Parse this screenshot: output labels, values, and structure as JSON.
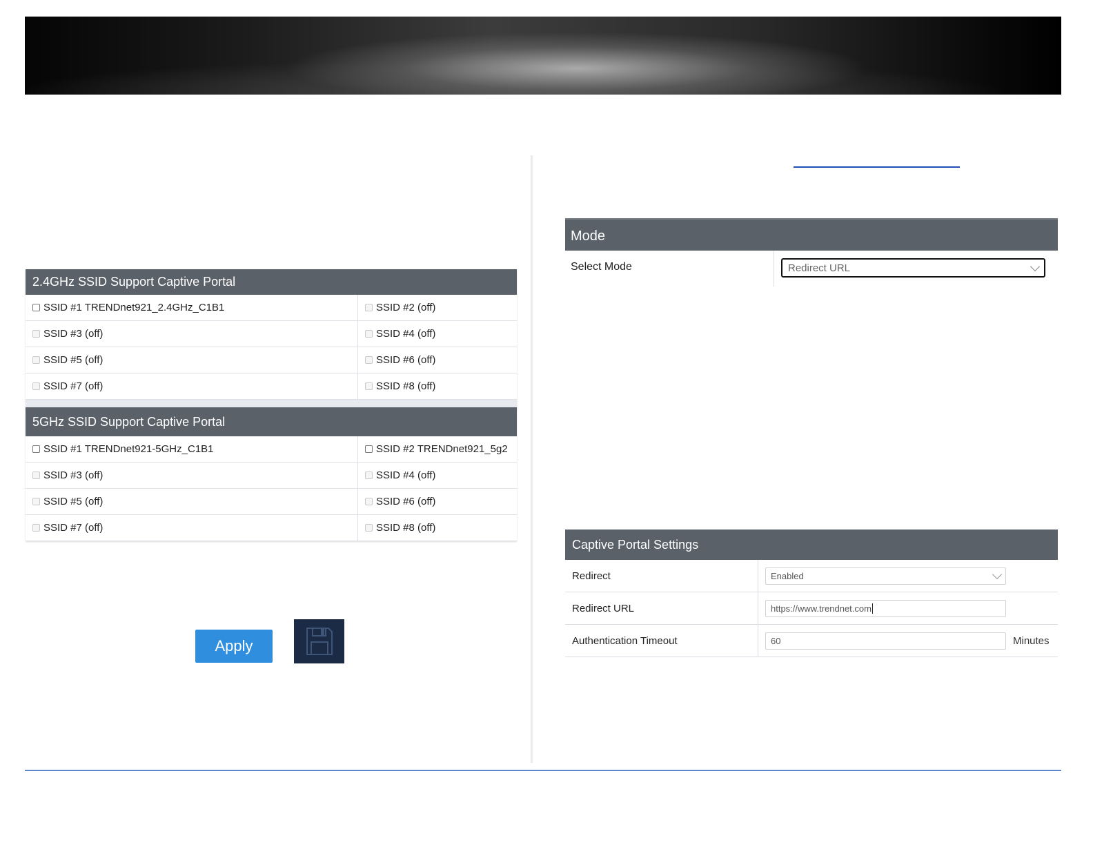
{
  "ssid_24": {
    "header": "2.4GHz SSID Support Captive Portal",
    "rows": [
      {
        "left": "SSID #1 TRENDnet921_2.4GHz_C1B1",
        "right": "SSID #2 (off)"
      },
      {
        "left": "SSID #3 (off)",
        "right": "SSID #4 (off)"
      },
      {
        "left": "SSID #5 (off)",
        "right": "SSID #6 (off)"
      },
      {
        "left": "SSID #7 (off)",
        "right": "SSID #8 (off)"
      }
    ]
  },
  "ssid_5": {
    "header": "5GHz SSID Support Captive Portal",
    "rows": [
      {
        "left": "SSID #1 TRENDnet921-5GHz_C1B1",
        "right": "SSID #2 TRENDnet921_5g2"
      },
      {
        "left": "SSID #3 (off)",
        "right": "SSID #4 (off)"
      },
      {
        "left": "SSID #5 (off)",
        "right": "SSID #6 (off)"
      },
      {
        "left": "SSID #7 (off)",
        "right": "SSID #8 (off)"
      }
    ]
  },
  "buttons": {
    "apply": "Apply",
    "save_icon": "floppy-disk"
  },
  "mode": {
    "header": "Mode",
    "select_label": "Select Mode",
    "select_value": "Redirect URL"
  },
  "captive": {
    "header": "Captive Portal Settings",
    "redirect_label": "Redirect",
    "redirect_value": "Enabled",
    "url_label": "Redirect URL",
    "url_value": "https://www.trendnet.com",
    "timeout_label": "Authentication Timeout",
    "timeout_value": "60",
    "timeout_unit": "Minutes"
  },
  "colors": {
    "header_bg": "#5a6169",
    "apply_bg": "#2f8fde",
    "save_bg": "#1c2b45",
    "link": "#1f4fb5"
  }
}
